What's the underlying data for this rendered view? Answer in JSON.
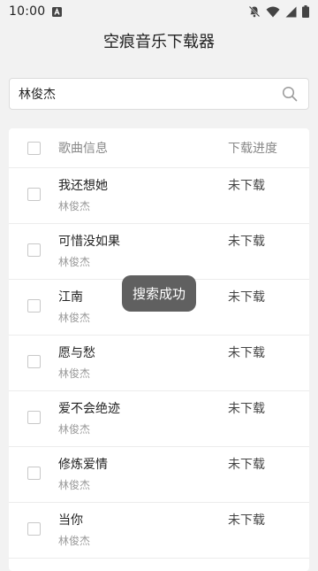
{
  "status_bar": {
    "time": "10:00",
    "icons": [
      "notification-a-icon",
      "notifications-off-icon",
      "wifi-icon",
      "cellular-signal-icon",
      "battery-icon"
    ]
  },
  "app_bar": {
    "title": "空痕音乐下载器"
  },
  "search": {
    "value": "林俊杰",
    "icon": "search-icon"
  },
  "list": {
    "header": {
      "title": "歌曲信息",
      "progress": "下载进度"
    },
    "items": [
      {
        "title": "我还想她",
        "artist": "林俊杰",
        "status": "未下载"
      },
      {
        "title": "可惜没如果",
        "artist": "林俊杰",
        "status": "未下载"
      },
      {
        "title": "江南",
        "artist": "林俊杰",
        "status": "未下载"
      },
      {
        "title": "愿与愁",
        "artist": "林俊杰",
        "status": "未下载"
      },
      {
        "title": "爱不会绝迹",
        "artist": "林俊杰",
        "status": "未下载"
      },
      {
        "title": "修炼爱情",
        "artist": "林俊杰",
        "status": "未下载"
      },
      {
        "title": "当你",
        "artist": "林俊杰",
        "status": "未下载"
      }
    ]
  },
  "toast": {
    "message": "搜索成功"
  }
}
